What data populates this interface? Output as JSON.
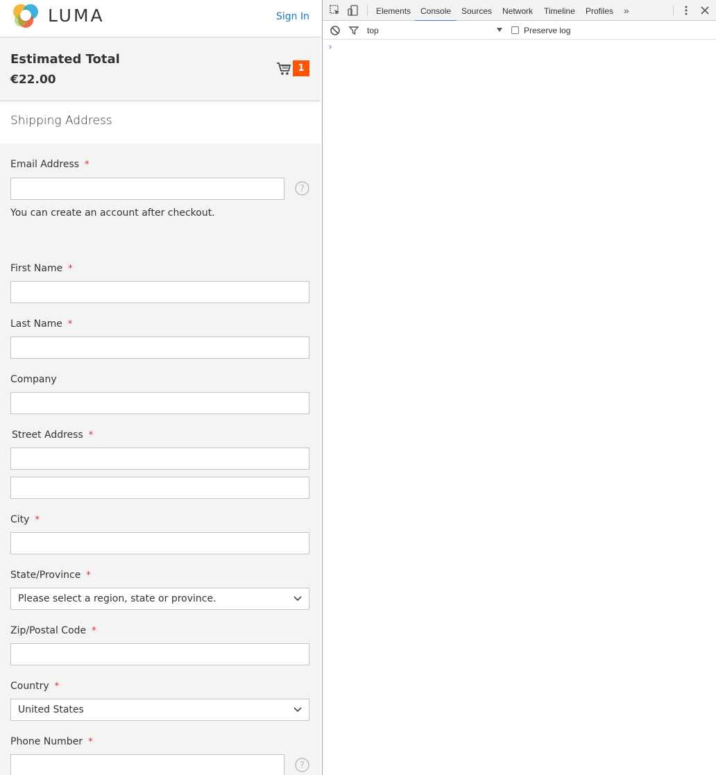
{
  "header": {
    "logo_text": "LUMA",
    "sign_in": "Sign In"
  },
  "summary": {
    "label": "Estimated Total",
    "value": "€22.00",
    "cart_count": "1"
  },
  "section": {
    "title": "Shipping Address"
  },
  "form": {
    "required_mark": "*",
    "email_label": "Email Address",
    "email_note": "You can create an account after checkout.",
    "first_name_label": "First Name",
    "last_name_label": "Last Name",
    "company_label": "Company",
    "street_label": "Street Address",
    "city_label": "City",
    "state_label": "State/Province",
    "state_value": "Please select a region, state or province.",
    "zip_label": "Zip/Postal Code",
    "country_label": "Country",
    "country_value": "United States",
    "phone_label": "Phone Number"
  },
  "devtools": {
    "tabs": [
      "Elements",
      "Console",
      "Sources",
      "Network",
      "Timeline",
      "Profiles"
    ],
    "active_tab": "Console",
    "more": "»",
    "context": "top",
    "preserve_log": "Preserve log",
    "prompt": "›"
  },
  "colors": {
    "accent_link": "#1979c3",
    "cart_badge": "#ff5501",
    "required": "#e02b27",
    "devtools_active": "#3879d9"
  }
}
